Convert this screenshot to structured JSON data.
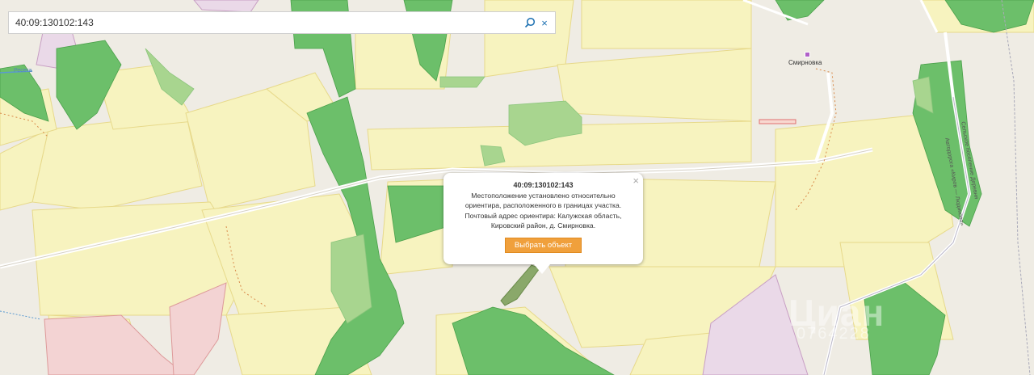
{
  "search": {
    "value": "40:09:130102:143",
    "clear_label": "×"
  },
  "popup": {
    "close_label": "×",
    "title": "40:09:130102:143",
    "lines": [
      "Местоположение установлено относительно",
      "ориентира, расположенного в границах участка.",
      "Почтовый адрес ориентира: Калужская область,",
      "Кировский район, д. Смирновка."
    ],
    "button_label": "Выбрать объект"
  },
  "map": {
    "place_name": "Смирновка",
    "river_label": "Ресета",
    "road_label_1": "Автодорога «Киров — Людиново»",
    "road_label_2": "Сельское поселение Деревня"
  },
  "watermark": {
    "brand": "Циан",
    "number": "0764228"
  },
  "colors": {
    "background": "#efece4",
    "field": "#f7f3bf",
    "field_border": "#e7d98a",
    "forest": "#6cbf6a",
    "forest_light": "#a8d58f",
    "residential": "#f3d3d3",
    "pink_zone": "#ead9e8",
    "selected_parcel": "#8aa86a",
    "button": "#f0a03c",
    "link_blue": "#1a6fb0"
  },
  "icons": {
    "search": "magnifier-icon",
    "clear": "close-icon",
    "popup_close": "close-icon",
    "place": "square-marker-icon"
  }
}
